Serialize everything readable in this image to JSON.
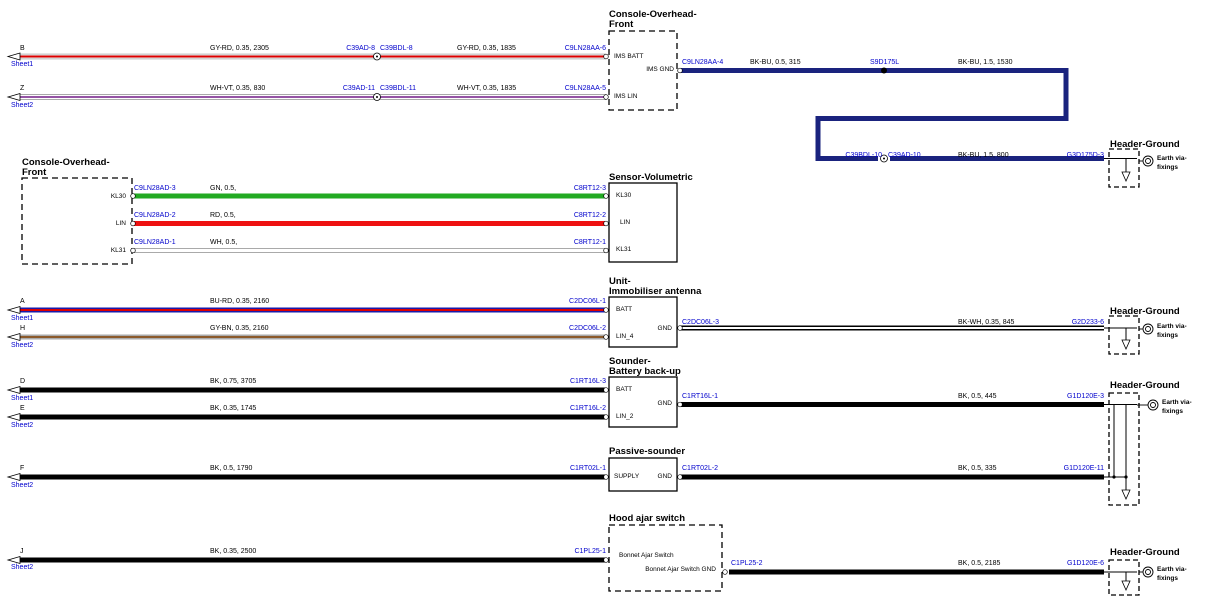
{
  "colors": {
    "wire_text": "#000000",
    "connector_text": "#0000cc",
    "GY-RD": "#e8e8e8|#dd0000",
    "WH-VT": "#ffffff|#7b2b8f",
    "GN": "#22aa22",
    "RD": "#ee1111",
    "WH": "#ffffff",
    "BU-RD": "#1a1aaa|#dd0000",
    "GY-BN": "#aaaaaa|#8b5a2b",
    "BK": "#000000",
    "BK-BU": "#1a237e",
    "BK-WH": "#000000|#ffffff"
  },
  "boxes": [
    {
      "id": "console_front_top",
      "title": [
        "Console-Overhead-",
        "Front"
      ],
      "pins": [
        "IMS BATT",
        "IMS LIN",
        "IMS GND"
      ]
    },
    {
      "id": "console_front_left",
      "title": [
        "Console-Overhead-",
        "Front"
      ],
      "pins": [
        "KL30",
        "LIN",
        "KL31"
      ]
    },
    {
      "id": "sensor_volumetric",
      "title": [
        "Sensor-Volumetric"
      ],
      "pins": [
        "KL30",
        "LIN",
        "KL31"
      ]
    },
    {
      "id": "unit_immobiliser",
      "title": [
        "Unit-",
        "Immobiliser antenna"
      ],
      "pins": [
        "BATT",
        "LIN_4",
        "GND"
      ]
    },
    {
      "id": "sounder_battery",
      "title": [
        "Sounder-",
        "Battery back-up"
      ],
      "pins": [
        "BATT",
        "LIN_2",
        "GND"
      ]
    },
    {
      "id": "passive_sounder",
      "title": [
        "Passive-sounder"
      ],
      "pins": [
        "SUPPLY",
        "GND"
      ]
    },
    {
      "id": "hood_ajar",
      "title": [
        "Hood ajar switch"
      ],
      "pins": [
        "Bonnet Ajar Switch",
        "Bonnet Ajar Switch GND"
      ]
    }
  ],
  "grounds": [
    {
      "title": "Header-Ground",
      "earth": [
        "Earth via-",
        "fixings"
      ]
    },
    {
      "title": "Header-Ground",
      "earth": [
        "Earth via-",
        "fixings"
      ]
    },
    {
      "title": "Header-Ground",
      "earth": [
        "Earth via-",
        "fixings"
      ]
    },
    {
      "title": "Header-Ground",
      "earth": [
        "Earth via-",
        "fixings"
      ]
    }
  ],
  "offsheet": [
    {
      "letter": "B",
      "sheet": "Sheet1"
    },
    {
      "letter": "Z",
      "sheet": "Sheet2"
    },
    {
      "letter": "A",
      "sheet": "Sheet1"
    },
    {
      "letter": "H",
      "sheet": "Sheet2"
    },
    {
      "letter": "D",
      "sheet": "Sheet1"
    },
    {
      "letter": "E",
      "sheet": "Sheet2"
    },
    {
      "letter": "F",
      "sheet": "Sheet2"
    },
    {
      "letter": "J",
      "sheet": "Sheet2"
    }
  ],
  "wire_labels": [
    "GY-RD,  0.35,  2305",
    "GY-RD,  0.35,  1835",
    "WH-VT,  0.35,  830",
    "WH-VT,  0.35,  1835",
    "BK-BU,  0.5,  315",
    "BK-BU,  1.5,  1530",
    "BK-BU,  1.5,  800",
    "GN,  0.5,",
    "RD,  0.5,",
    "WH,  0.5,",
    "BU-RD,  0.35,  2160",
    "GY-BN,  0.35,  2160",
    "BK-WH,  0.35,  845",
    "BK,  0.75,  3705",
    "BK,  0.35,  1745",
    "BK,  0.5,  445",
    "BK,  0.5,  1790",
    "BK,  0.5,  335",
    "BK,  0.35,  2500",
    "BK,  0.5,  2185"
  ],
  "connector_labels": [
    "C39AD-8",
    "C39BDL-8",
    "C9LN28AA-6",
    "C39AD-11",
    "C39BDL-11",
    "C9LN28AA-5",
    "C9LN28AA-4",
    "S9D175L",
    "C39BDL-10",
    "C39AD-10",
    "G3D175D-3",
    "C9LN28AD-3",
    "C9LN28AD-2",
    "C9LN28AD-1",
    "C8RT12-3",
    "C8RT12-2",
    "C8RT12-1",
    "C2DC06L-1",
    "C2DC06L-2",
    "C2DC06L-3",
    "G2D233-6",
    "C1RT16L-3",
    "C1RT16L-2",
    "C1RT16L-1",
    "G1D120E-3",
    "C1RT02L-1",
    "C1RT02L-2",
    "G1D120E-11",
    "C1PL25-1",
    "C1PL25-2",
    "G1D120E-6"
  ]
}
